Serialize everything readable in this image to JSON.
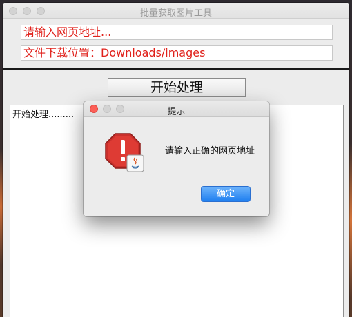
{
  "window": {
    "title": "批量获取图片工具"
  },
  "form": {
    "url_placeholder": "请输入网页地址...",
    "save_location": "文件下载位置：Downloads/images",
    "start_button": "开始处理"
  },
  "log": {
    "text": "开始处理........."
  },
  "dialog": {
    "title": "提示",
    "message": "请输入正确的网页地址",
    "ok_button": "确定",
    "icon": "error-stop-icon"
  },
  "colors": {
    "field_text": "#e0211b",
    "accent_button": "#1f7ff0",
    "close_red": "#fc5f57"
  }
}
